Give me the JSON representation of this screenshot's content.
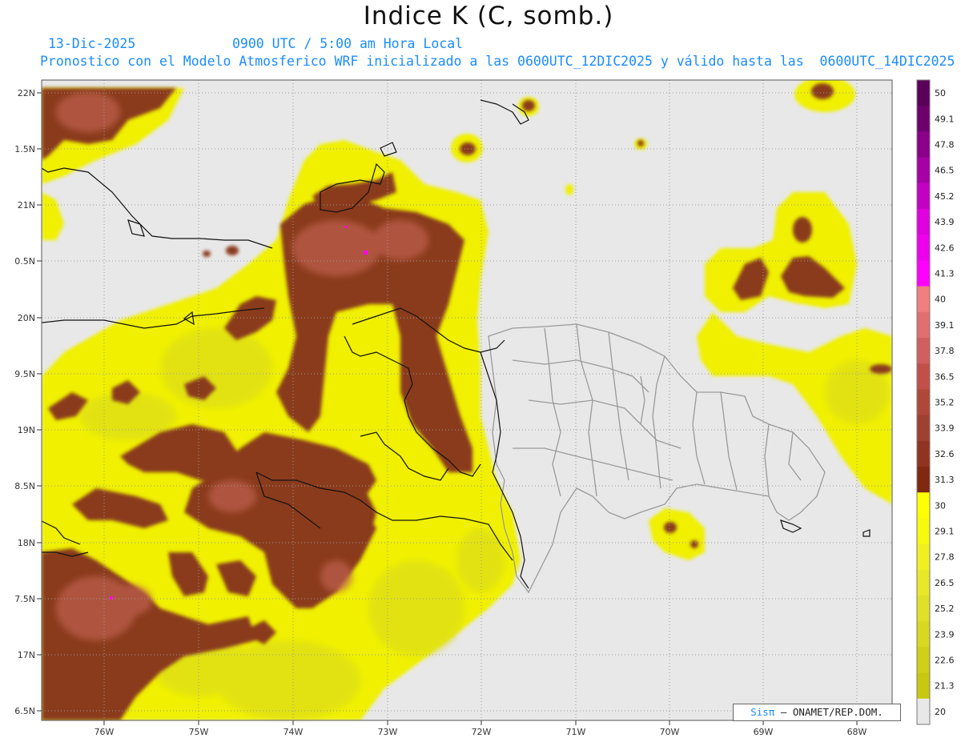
{
  "header": {
    "title": "Indice K (C, somb.)",
    "date": "13-Dic-2025",
    "time": "0900 UTC / 5:00 am Hora Local",
    "description": "Pronostico con el Modelo Atmosferico WRF inicializado a las 0600UTC_12DIC2025 y válido hasta las  0600UTC_14DIC2025"
  },
  "map": {
    "lat_labels": [
      "22N",
      "1.5N",
      "21N",
      "0.5N",
      "20N",
      "9.5N",
      "19N",
      "8.5N",
      "18N",
      "7.5N",
      "17N",
      "6.5N"
    ],
    "lon_labels": [
      "76W",
      "75W",
      "74W",
      "73W",
      "72W",
      "71W",
      "70W",
      "69W",
      "68W"
    ],
    "background_color": "#e8e8e8"
  },
  "colorbar": {
    "labels": [
      "50",
      "49.1",
      "47.8",
      "46.5",
      "45.2",
      "43.9",
      "42.6",
      "41.3",
      "40",
      "39.1",
      "37.8",
      "36.5",
      "35.2",
      "33.9",
      "32.6",
      "31.3",
      "30",
      "29.1",
      "27.8",
      "26.5",
      "25.2",
      "23.9",
      "22.6",
      "21.3",
      "20"
    ],
    "colors": [
      "#5a005a",
      "#6e006e",
      "#8a008a",
      "#a600a6",
      "#c400c4",
      "#e000e0",
      "#ee00ee",
      "#ff00ff",
      "#f08080",
      "#e07070",
      "#d06060",
      "#c05048",
      "#b04838",
      "#a04030",
      "#903420",
      "#802810",
      "#ffff00",
      "#f8f810",
      "#f0f020",
      "#e8e828",
      "#e0e028",
      "#d8d820",
      "#d0d018",
      "#c8c810",
      "#e8e8e8"
    ]
  },
  "credit": {
    "sis": "Sisπ",
    "text": "ONAMET/REP.DOM."
  }
}
